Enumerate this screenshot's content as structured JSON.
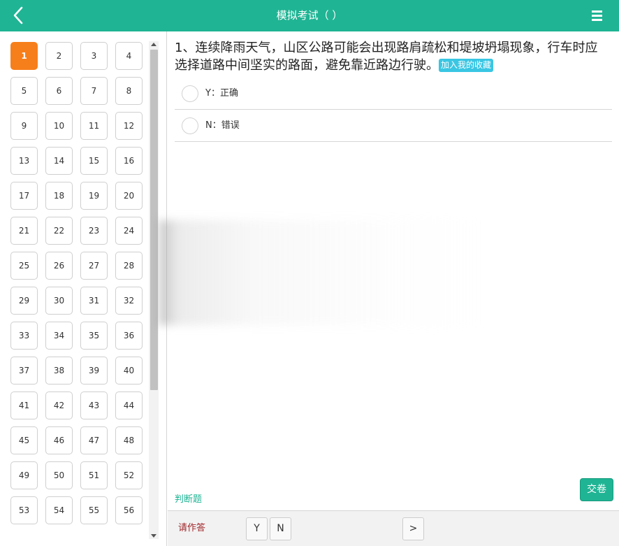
{
  "header": {
    "title": "模拟考试（ ）",
    "back_icon": "chevron-left-icon",
    "menu_icon": "hamburger-menu-icon",
    "color": "#1fb494"
  },
  "sidebar": {
    "current": "1",
    "numbers": [
      "1",
      "2",
      "3",
      "4",
      "5",
      "6",
      "7",
      "8",
      "9",
      "10",
      "11",
      "12",
      "13",
      "14",
      "15",
      "16",
      "17",
      "18",
      "19",
      "20",
      "21",
      "22",
      "23",
      "24",
      "25",
      "26",
      "27",
      "28",
      "29",
      "30",
      "31",
      "32",
      "33",
      "34",
      "35",
      "36",
      "37",
      "38",
      "39",
      "40",
      "41",
      "42",
      "43",
      "44",
      "45",
      "46",
      "47",
      "48",
      "49",
      "50",
      "51",
      "52",
      "53",
      "54",
      "55",
      "56"
    ],
    "active_color": "#f77f1b"
  },
  "question": {
    "text": "1、连续降雨天气，山区公路可能会出现路肩疏松和堤坡坍塌现象，行车时应选择道路中间坚实的路面，避免靠近路边行驶。",
    "fav_label": "加入我的收藏",
    "options": [
      {
        "label": "Y：正确"
      },
      {
        "label": "N：错误"
      }
    ],
    "type_label": "判断题"
  },
  "submit_label": "交卷",
  "footer": {
    "prompt": "请作答",
    "btn_y": "Y",
    "btn_n": "N",
    "btn_next": ">"
  }
}
